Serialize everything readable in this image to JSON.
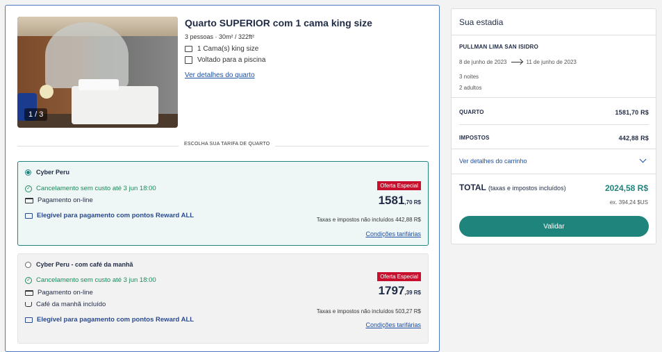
{
  "room": {
    "photo_counter": "1 / 3",
    "title": "Quarto SUPERIOR com 1 cama king size",
    "meta": "3 pessoas  ·  30m² / 322ft²",
    "features": [
      "1 Cama(s) king size",
      "Voltado para a piscina"
    ],
    "details_link": "Ver detalhes do quarto"
  },
  "rate_header": "ESCOLHA SUA TARIFA DE QUARTO",
  "rates": [
    {
      "name": "Cyber Peru",
      "selected": true,
      "cancel": "Cancelamento sem custo até 3 jun 18:00",
      "payment": "Pagamento on-line",
      "reward": "Elegível para pagamento com pontos Reward ALL",
      "badge": "Oferta Especial",
      "price_main": "1581",
      "price_cents": ",70 R$",
      "tax_note": "Taxas e impostos não incluídos 442,88 R$",
      "conditions": "Condições tarifárias"
    },
    {
      "name": "Cyber Peru - com café da manhã",
      "selected": false,
      "cancel": "Cancelamento sem custo até 3 jun 18:00",
      "payment": "Pagamento on-line",
      "breakfast": "Café da manhã incluído",
      "reward": "Elegível para pagamento com pontos Reward ALL",
      "badge": "Oferta Especial",
      "price_main": "1797",
      "price_cents": ",39 R$",
      "tax_note": "Taxas e impostos não incluídos 503,27 R$",
      "conditions": "Condições tarifárias"
    }
  ],
  "stay": {
    "title": "Sua estadia",
    "hotel": "PULLMAN LIMA SAN ISIDRO",
    "checkin": "8 de junho de 2023",
    "checkout": "11 de junho de 2023",
    "nights": "3 noites",
    "adults": "2 adultos",
    "room_label": "QUARTO",
    "room_value": "1581,70 R$",
    "tax_label": "IMPOSTOS",
    "tax_value": "442,88 R$",
    "cart_link": "Ver detalhes do carrinho",
    "total_label": "TOTAL",
    "total_sub": "(taxas e impostos incluídos)",
    "total_value": "2024,58 R$",
    "total_usd": "ex. 394,24 $US",
    "validate": "Validar"
  },
  "colors": {
    "accent": "#1e847c",
    "badge": "#c8102e",
    "link": "#1f4fa3"
  }
}
